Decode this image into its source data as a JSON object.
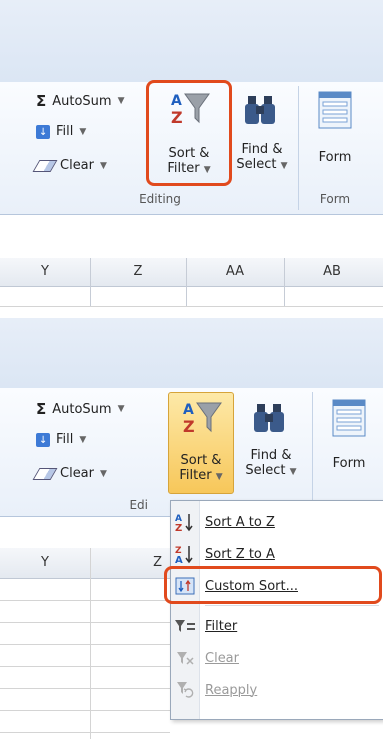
{
  "top": {
    "autosum_label": "AutoSum",
    "fill_label": "Fill",
    "clear_label": "Clear",
    "sort_line1": "Sort &",
    "sort_line2": "Filter",
    "find_line1": "Find &",
    "find_line2": "Select",
    "form_label": "Form",
    "editing_group": "Editing",
    "form_group": "Form"
  },
  "grid_top": {
    "columns": [
      "Y",
      "Z",
      "AA",
      "AB"
    ]
  },
  "bottom": {
    "autosum_label": "AutoSum",
    "fill_label": "Fill",
    "clear_label": "Clear",
    "sort_line1": "Sort &",
    "sort_line2": "Filter",
    "find_line1": "Find &",
    "find_line2": "Select",
    "form_label": "Form",
    "editing_group_partial": "Edi",
    "columns": [
      "Y",
      "Z"
    ]
  },
  "menu": {
    "items": [
      {
        "label": "Sort A to Z",
        "icon": "sort-a-z-icon",
        "enabled": true
      },
      {
        "label": "Sort Z to A",
        "icon": "sort-z-a-icon",
        "enabled": true
      },
      {
        "label": "Custom Sort...",
        "icon": "custom-sort-icon",
        "enabled": true,
        "highlighted": true
      },
      {
        "label": "Filter",
        "icon": "filter-icon",
        "enabled": true
      },
      {
        "label": "Clear",
        "icon": "clear-filter-icon",
        "enabled": false
      },
      {
        "label": "Reapply",
        "icon": "reapply-icon",
        "enabled": false
      }
    ]
  },
  "colors": {
    "highlight": "#e14a1d",
    "ribbon_border": "#b6c6dc",
    "active_button": "#fbd97c"
  }
}
